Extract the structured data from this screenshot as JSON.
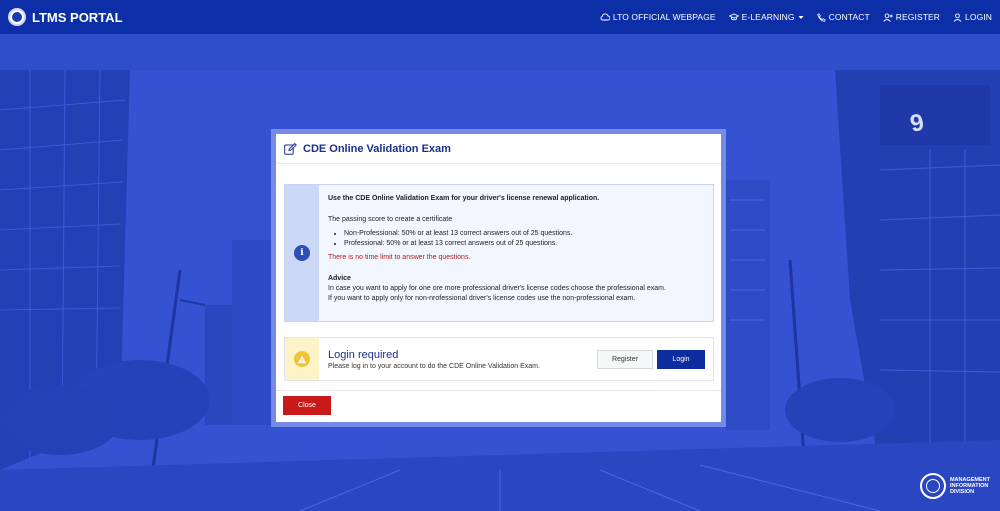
{
  "navbar": {
    "brand": "LTMS PORTAL",
    "links": [
      {
        "label": "LTO OFFICIAL WEBPAGE",
        "icon": "cloud-icon"
      },
      {
        "label": "E-LEARNING",
        "icon": "graduation-cap-icon"
      },
      {
        "label": "CONTACT",
        "icon": "phone-icon"
      },
      {
        "label": "REGISTER",
        "icon": "user-plus-icon"
      },
      {
        "label": "LOGIN",
        "icon": "user-icon"
      }
    ]
  },
  "modal": {
    "title": "CDE Online Validation Exam",
    "info": {
      "heading": "Use the CDE Online Validation Exam for your driver's license renewal application.",
      "passing_label": "The passing score to create a certificate",
      "bullets": [
        "Non-Professional: 50% or at least 13 correct answers out of 25 questions.",
        "Professional: 50% or at least 13 correct answers out of 25 questions."
      ],
      "time_limit": "There is no time limit to answer the questions.",
      "advice_title": "Advice",
      "advice_lines": [
        "In case you want to apply for one ore more professional driver's license codes choose the professional exam.",
        "If you want to apply only for non-nrofessional driver's license codes use the non-professional exam."
      ]
    },
    "login": {
      "title": "Login required",
      "description": "Please log in to your account to do the CDE Online Validation Exam.",
      "register_label": "Register",
      "login_label": "Login"
    },
    "close_label": "Close"
  },
  "footer_logo": {
    "lines": [
      "MANAGEMENT",
      "INFORMATION",
      "DIVISION"
    ]
  },
  "colors": {
    "navbar": "#0c2fa8",
    "accent": "#1c2e8c",
    "login_button": "#0d2c9e",
    "close_button": "#c91a1a",
    "time_limit_text": "#b01c1c"
  }
}
